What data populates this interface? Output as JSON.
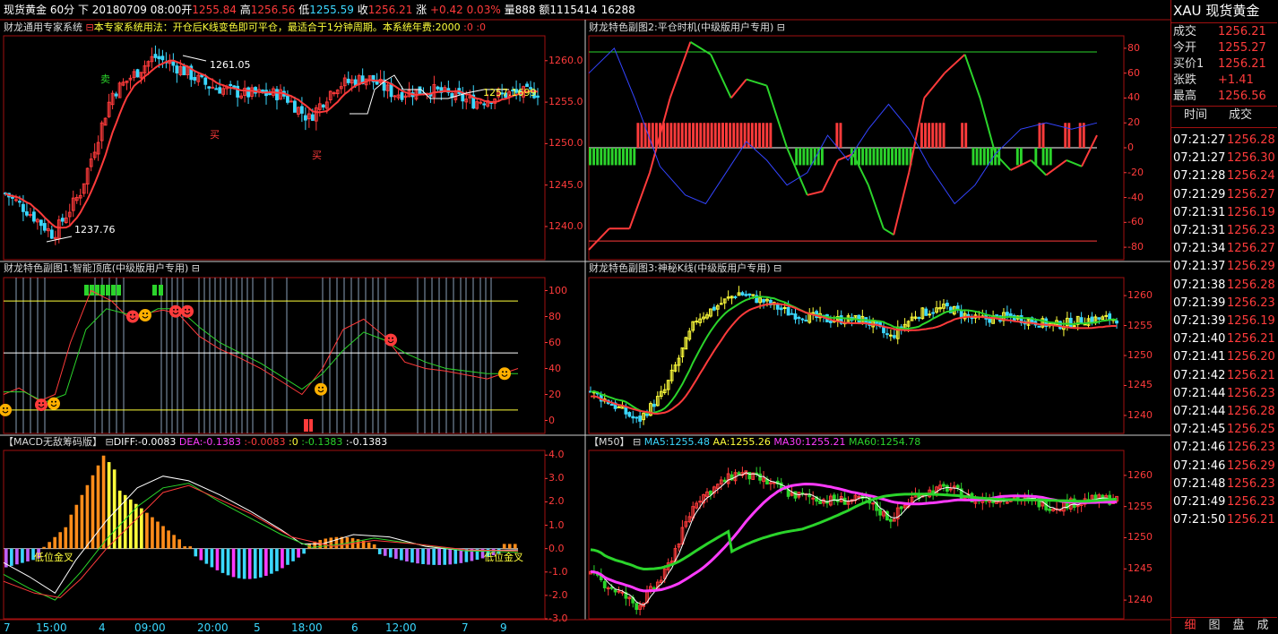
{
  "topbar": {
    "symbol": "现货黄金",
    "period": "60分",
    "direction": "下",
    "datetime": "20180709 08:00",
    "open_label": "开",
    "open": "1255.84",
    "high_label": "高",
    "high": "1256.56",
    "low_label": "低",
    "low": "1255.59",
    "close_label": "收",
    "close": "1256.21",
    "change_label": "涨",
    "change": "+0.42",
    "change_pct": "0.03%",
    "volume_label": "量",
    "volume": "888",
    "amount_label": "额",
    "amount": "1115414",
    "extra": "16288"
  },
  "panels": {
    "main": {
      "title_prefix": "财龙通用专家系统",
      "title_icon": "⊟",
      "title_note": "本专家系统用法：开仓后K线变色即可平仓，最适合于1分钟周期。本系统年费:2000",
      "title_zeros": ":0 :0",
      "annotations": {
        "high": "1261.05",
        "low": "1237.76",
        "last": "1257.1699",
        "sell": "卖",
        "buy1": "买",
        "buy2": "买"
      },
      "yticks": [
        "1260.0",
        "1255.0",
        "1250.0",
        "1245.0",
        "1240.0"
      ]
    },
    "sub1": {
      "title": "财龙特色副图1:智能顶底(中级版用户专用)",
      "title_icon": "⊟",
      "yticks": [
        "100",
        "80",
        "60",
        "40",
        "20",
        "0"
      ]
    },
    "sub2": {
      "title": "财龙特色副图2:平仓时机(中级版用户专用)",
      "title_icon": "⊟",
      "yticks": [
        "80",
        "60",
        "40",
        "20",
        "0",
        "-20",
        "-40",
        "-60",
        "-80"
      ]
    },
    "sub3": {
      "title": "财龙特色副图3:神秘K线(中级版用户专用)",
      "title_icon": "⊟",
      "yticks": [
        "1260",
        "1255",
        "1250",
        "1245",
        "1240"
      ]
    },
    "macd": {
      "title": "【MACD无敌筹码版】",
      "title_icon": "⊟",
      "diff_label": "DIFF:",
      "diff": "-0.0083",
      "dea_label": "DEA:",
      "dea": "-0.1383",
      "v1": ":-0.0083",
      "v2": ":0",
      "v3": ":-0.1383",
      "v4": ":-0.1383",
      "note1": "低位金叉",
      "note2": "低位金叉",
      "yticks": [
        "4.0",
        "3.0",
        "2.0",
        "1.0",
        "0.0",
        "-1.0",
        "-2.0",
        "-3.0"
      ]
    },
    "m50": {
      "title": "【M50】",
      "title_icon": "⊟",
      "ma5_label": "MA5:",
      "ma5": "1255.48",
      "aa_label": "AA:",
      "aa": "1255.26",
      "ma30_label": "MA30:",
      "ma30": "1255.21",
      "ma60_label": "MA60:",
      "ma60": "1254.78",
      "yticks": [
        "1260",
        "1255",
        "1250",
        "1245",
        "1240"
      ]
    }
  },
  "xaxis": [
    "7",
    "15:00",
    "4",
    "09:00",
    "20:00",
    "5",
    "18:00",
    "6",
    "12:00",
    "7",
    "9"
  ],
  "right_panel": {
    "code": "XAU",
    "name": "现货黄金",
    "quotes": [
      {
        "k": "成交",
        "v": "1256.21"
      },
      {
        "k": "今开",
        "v": "1255.27"
      },
      {
        "k": "买价1",
        "v": "1256.21"
      },
      {
        "k": "张跌",
        "v": "+1.41"
      },
      {
        "k": "最高",
        "v": "1256.56"
      }
    ],
    "ticks_header": {
      "time": "时间",
      "price": "成交"
    },
    "ticks": [
      {
        "t": "07:21:27",
        "p": "1256.28"
      },
      {
        "t": "07:21:27",
        "p": "1256.30"
      },
      {
        "t": "07:21:28",
        "p": "1256.24"
      },
      {
        "t": "07:21:29",
        "p": "1256.27"
      },
      {
        "t": "07:21:31",
        "p": "1256.19"
      },
      {
        "t": "07:21:31",
        "p": "1256.23"
      },
      {
        "t": "07:21:34",
        "p": "1256.27"
      },
      {
        "t": "07:21:37",
        "p": "1256.29"
      },
      {
        "t": "07:21:38",
        "p": "1256.28"
      },
      {
        "t": "07:21:39",
        "p": "1256.23"
      },
      {
        "t": "07:21:39",
        "p": "1256.19"
      },
      {
        "t": "07:21:40",
        "p": "1256.21"
      },
      {
        "t": "07:21:41",
        "p": "1256.20"
      },
      {
        "t": "07:21:42",
        "p": "1256.21"
      },
      {
        "t": "07:21:44",
        "p": "1256.23"
      },
      {
        "t": "07:21:44",
        "p": "1256.28"
      },
      {
        "t": "07:21:45",
        "p": "1256.25"
      },
      {
        "t": "07:21:46",
        "p": "1256.23"
      },
      {
        "t": "07:21:46",
        "p": "1256.29"
      },
      {
        "t": "07:21:48",
        "p": "1256.23"
      },
      {
        "t": "07:21:49",
        "p": "1256.23"
      },
      {
        "t": "07:21:50",
        "p": "1256.21"
      }
    ],
    "tabs": [
      "细",
      "图",
      "盘",
      "成"
    ],
    "colors": {
      "up": "#ff3b3b",
      "down": "#2bd42b",
      "frame": "#a01010"
    }
  }
}
